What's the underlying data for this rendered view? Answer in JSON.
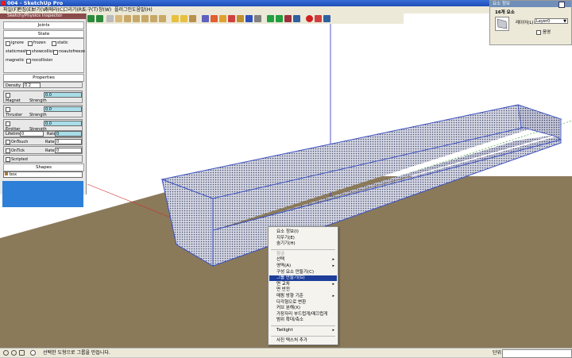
{
  "window": {
    "title": "004 - SketchUp Pro"
  },
  "menu": [
    "파일(F)",
    "편집(E)",
    "보기(V)",
    "카메라(C)",
    "그리기(R)",
    "도구(T)",
    "창(W)",
    "플러그인",
    "도움말(H)"
  ],
  "physics_panel": {
    "title": "SketchyPhysics Inspector",
    "joints_header": "Joints",
    "state_header": "State",
    "state_items": [
      "ignore",
      "frozen",
      "static",
      "staticmesh",
      "showcollision",
      "noautofreeze",
      "magnetic",
      "nocollision"
    ],
    "properties_header": "Properties",
    "density_label": "Density",
    "density_value": "0.2",
    "magnet_label": "Magnet",
    "strength_label": "Strength",
    "magnet_strength": "0.0",
    "thruster_label": "Thruster",
    "thruster_strength": "0.0",
    "emitter_label": "Emitter",
    "emitter_strength": "0.0",
    "lifetime_label": "Lifetime",
    "lifetime_value": "0",
    "rate_label": "Rate",
    "lifetime_rate": "0",
    "ontouch_label": "OnTouch",
    "ontouch_rate": "0",
    "ontick_label": "OnTick",
    "ontick_rate": "0",
    "scripted_label": "Scripted",
    "shapes_header": "Shapes",
    "shape_value": "box"
  },
  "entity_panel": {
    "title": "요소 정보",
    "count_text": "16개 요소",
    "layer_label": "레이어(L):",
    "layer_value": "Layer0",
    "soften_label": "음영"
  },
  "context_menu": [
    {
      "label": "요소 정보(I)",
      "state": "normal"
    },
    {
      "label": "지우기(E)",
      "state": "normal"
    },
    {
      "label": "숨기기(H)",
      "state": "normal"
    },
    {
      "sep": true
    },
    {
      "label": "잠금",
      "state": "disabled"
    },
    {
      "label": "선택",
      "state": "normal",
      "sub": true
    },
    {
      "label": "영역(A)",
      "state": "normal",
      "sub": true
    },
    {
      "label": "구성 요소 만들기(C)",
      "state": "normal"
    },
    {
      "label": "그룹 만들기(G)",
      "state": "highlight"
    },
    {
      "label": "면 교차",
      "state": "normal",
      "sub": true
    },
    {
      "label": "면 반전",
      "state": "normal"
    },
    {
      "label": "매핑 방향 기준",
      "state": "normal",
      "sub": true
    },
    {
      "label": "다각형으로 변환",
      "state": "normal"
    },
    {
      "label": "커브 분해(X)",
      "state": "normal"
    },
    {
      "label": "가장자리 부드럽게/매끄럽게",
      "state": "normal"
    },
    {
      "label": "범위 확대/축소",
      "state": "normal"
    },
    {
      "sep": true
    },
    {
      "label": "Twilight",
      "state": "normal",
      "sub": true
    },
    {
      "sep": true
    },
    {
      "label": "사진 텍스처 추가",
      "state": "normal"
    }
  ],
  "status_bar": {
    "text": "선택한 도형으로 그룹을 만듭니다.",
    "unit_label": "단위"
  },
  "colors": {
    "ground": "#8a7a5a",
    "sky": "#ffffff",
    "selection": "#3a4fc0",
    "highlight": "#1e3e9a"
  }
}
